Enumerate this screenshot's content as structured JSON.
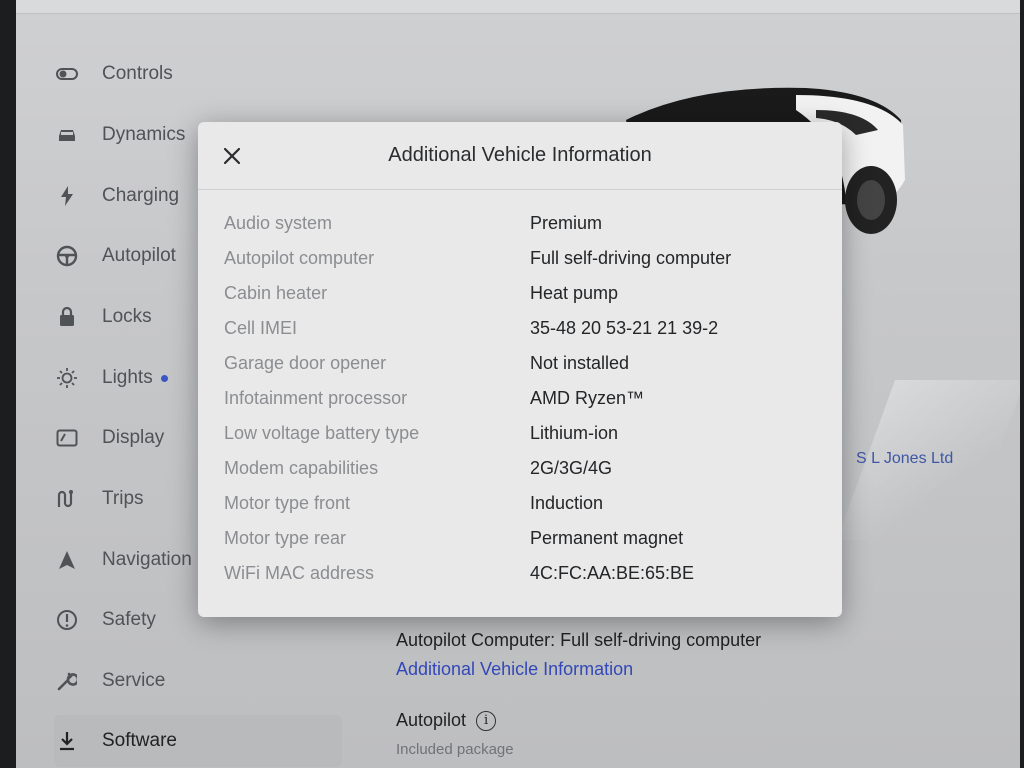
{
  "sidebar": {
    "items": [
      {
        "label": "Controls",
        "icon": "toggle-icon"
      },
      {
        "label": "Dynamics",
        "icon": "car-icon"
      },
      {
        "label": "Charging",
        "icon": "lightning-icon"
      },
      {
        "label": "Autopilot",
        "icon": "steering-wheel-icon"
      },
      {
        "label": "Locks",
        "icon": "lock-icon"
      },
      {
        "label": "Lights",
        "icon": "sun-icon"
      },
      {
        "label": "Display",
        "icon": "display-icon"
      },
      {
        "label": "Trips",
        "icon": "trips-icon"
      },
      {
        "label": "Navigation",
        "icon": "navigation-arrow-icon"
      },
      {
        "label": "Safety",
        "icon": "alert-circle-icon"
      },
      {
        "label": "Service",
        "icon": "wrench-icon"
      },
      {
        "label": "Software",
        "icon": "download-icon"
      }
    ],
    "active": "Software"
  },
  "background": {
    "owner_name": "S L Jones Ltd",
    "autopilot_computer_line": "Autopilot Computer: Full self-driving computer",
    "additional_info_link": "Additional Vehicle Information",
    "autopilot_heading": "Autopilot",
    "autopilot_package": "Included package"
  },
  "modal": {
    "title": "Additional Vehicle Information",
    "rows": [
      {
        "label": "Audio system",
        "value": "Premium"
      },
      {
        "label": "Autopilot computer",
        "value": "Full self-driving computer"
      },
      {
        "label": "Cabin heater",
        "value": "Heat pump"
      },
      {
        "label": "Cell IMEI",
        "value": "35-48 20 53-21 21 39-2"
      },
      {
        "label": "Garage door opener",
        "value": "Not installed"
      },
      {
        "label": "Infotainment processor",
        "value": "AMD Ryzen™"
      },
      {
        "label": "Low voltage battery type",
        "value": "Lithium-ion"
      },
      {
        "label": "Modem capabilities",
        "value": "2G/3G/4G"
      },
      {
        "label": "Motor type front",
        "value": "Induction"
      },
      {
        "label": "Motor type rear",
        "value": "Permanent magnet"
      },
      {
        "label": "WiFi MAC address",
        "value": "4C:FC:AA:BE:65:BE"
      }
    ]
  },
  "colors": {
    "link": "#3348b8",
    "notification_dot": "#3a55c4"
  }
}
